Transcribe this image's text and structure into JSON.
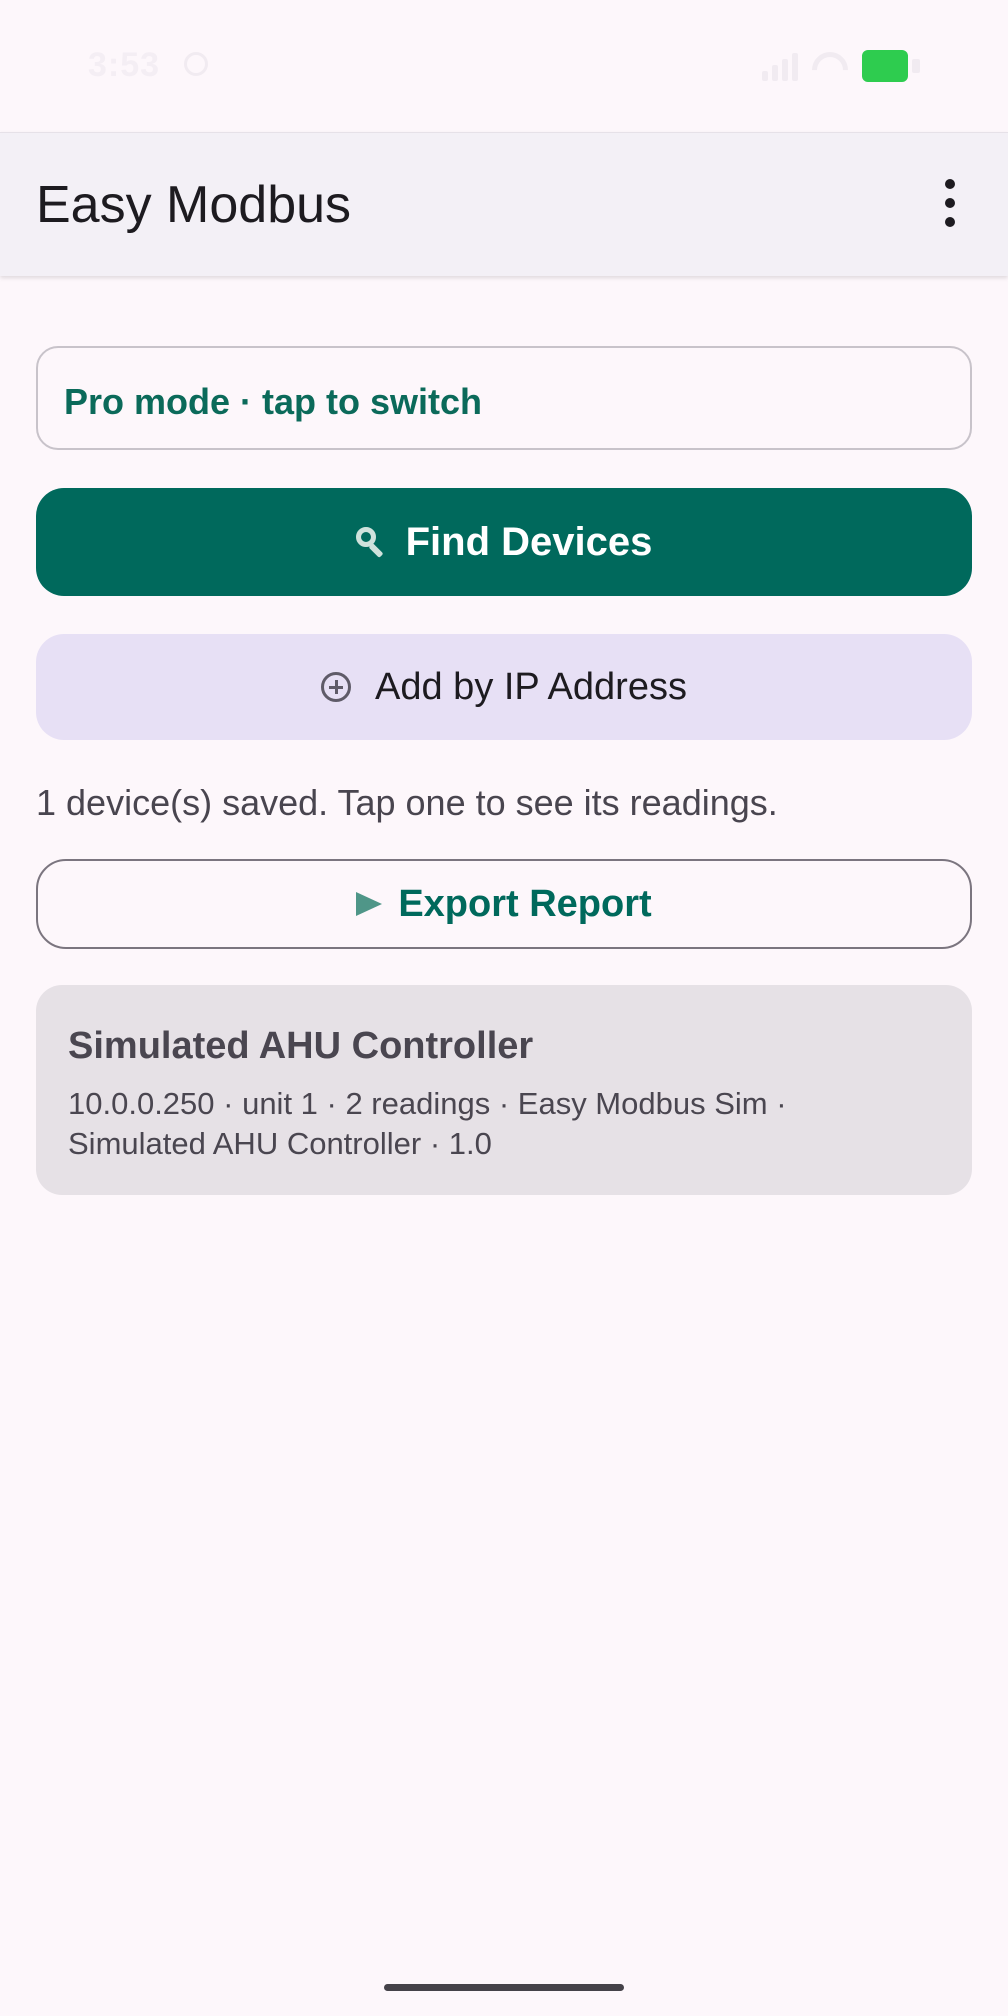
{
  "status_bar": {
    "time": "3:53"
  },
  "app_bar": {
    "title": "Easy Modbus",
    "menu_icon": "more-vert-icon"
  },
  "mode_chip": {
    "label": "Pro mode · tap to switch"
  },
  "actions": {
    "find_devices": {
      "label": "Find Devices",
      "icon": "search-icon"
    },
    "add_by_ip": {
      "label": "Add by IP Address",
      "icon": "add-circle-icon"
    },
    "export_report": {
      "label": "Export Report",
      "icon": "send-icon"
    }
  },
  "saved_summary": "1 device(s) saved. Tap one to see its readings.",
  "devices": [
    {
      "name": "Simulated AHU Controller",
      "info": "10.0.0.250 · unit 1 · 2 readings · Easy Modbus Sim · Simulated AHU Controller · 1.0"
    }
  ],
  "colors": {
    "primary": "#00695c",
    "primary_text": "#0b6a5a",
    "secondary_container": "#e7e0f5",
    "surface": "#fdf7fb",
    "card": "#e6e1e6",
    "battery": "#2ecc4f"
  }
}
